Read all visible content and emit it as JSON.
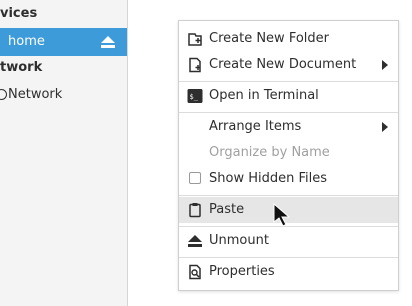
{
  "sidebar": {
    "devices_header": "vices",
    "network_header": "twork",
    "items": [
      {
        "label": "home"
      },
      {
        "label": "Network"
      }
    ]
  },
  "context_menu": {
    "items": [
      {
        "label": "Create New Folder",
        "icon": "new-folder-icon"
      },
      {
        "label": "Create New Document",
        "icon": "new-document-icon",
        "submenu": true
      },
      {
        "label": "Open in Terminal",
        "icon": "terminal-icon"
      },
      {
        "label": "Arrange Items",
        "submenu": true
      },
      {
        "label": "Organize by Name",
        "disabled": true
      },
      {
        "label": "Show Hidden Files",
        "checkbox": false
      },
      {
        "label": "Paste",
        "icon": "clipboard-icon",
        "highlighted": true
      },
      {
        "label": "Unmount",
        "icon": "eject-icon"
      },
      {
        "label": "Properties",
        "icon": "properties-icon"
      }
    ]
  },
  "colors": {
    "selection": "#3d9bda",
    "menu_highlight": "#e6e6e6",
    "sidebar_bg": "#f4f4f4"
  }
}
